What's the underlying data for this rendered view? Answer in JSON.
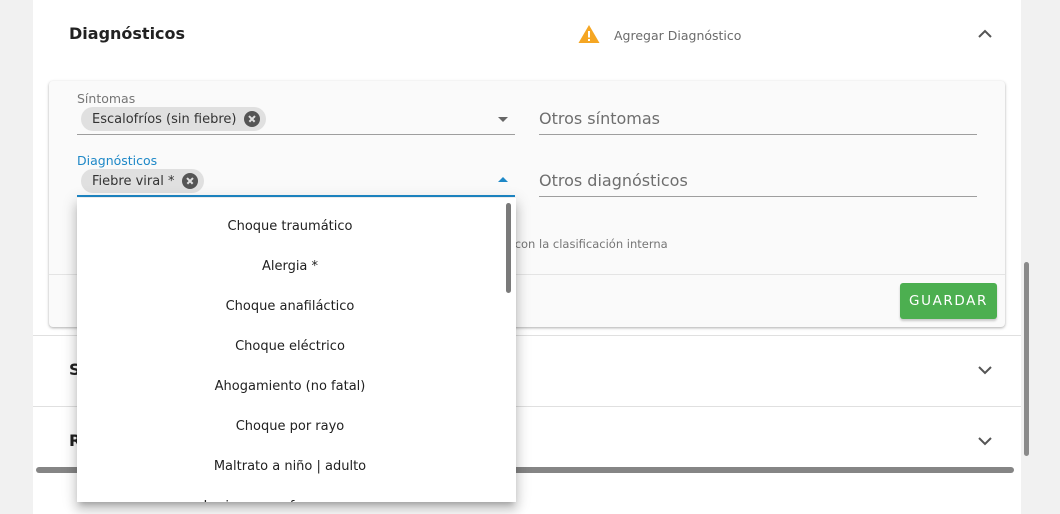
{
  "header": {
    "title": "Diagnósticos",
    "add_diagnosis_label": "Agregar Diagnóstico",
    "warning_icon": "warning-triangle-icon",
    "warning_color": "#f5a623",
    "collapse_icon": "chevron-up-icon"
  },
  "form": {
    "symptoms": {
      "label": "Síntomas",
      "chips": [
        "Escalofríos (sin fiebre)"
      ]
    },
    "other_symptoms": {
      "placeholder": "Otros síntomas"
    },
    "diagnoses": {
      "label": "Diagnósticos",
      "chips": [
        "Fiebre viral *"
      ]
    },
    "other_diagnoses": {
      "placeholder": "Otros diagnósticos"
    },
    "helper_text": "a con la clasificación interna",
    "save_label": "GUARDAR",
    "accent_color": "#1e88c7",
    "save_color": "#4caf50"
  },
  "collapsed_sections": [
    {
      "title_fragment": "S",
      "icon": "chevron-down-icon"
    },
    {
      "title_fragment": "R",
      "icon": "chevron-down-icon"
    }
  ],
  "dropdown": {
    "options": [
      "Choque traumático",
      "Alergia *",
      "Choque anafiláctico",
      "Choque eléctrico",
      "Ahogamiento (no fatal)",
      "Choque por rayo",
      "Maltrato a niño | adulto",
      "Lesiones por fuerza mayor"
    ]
  }
}
